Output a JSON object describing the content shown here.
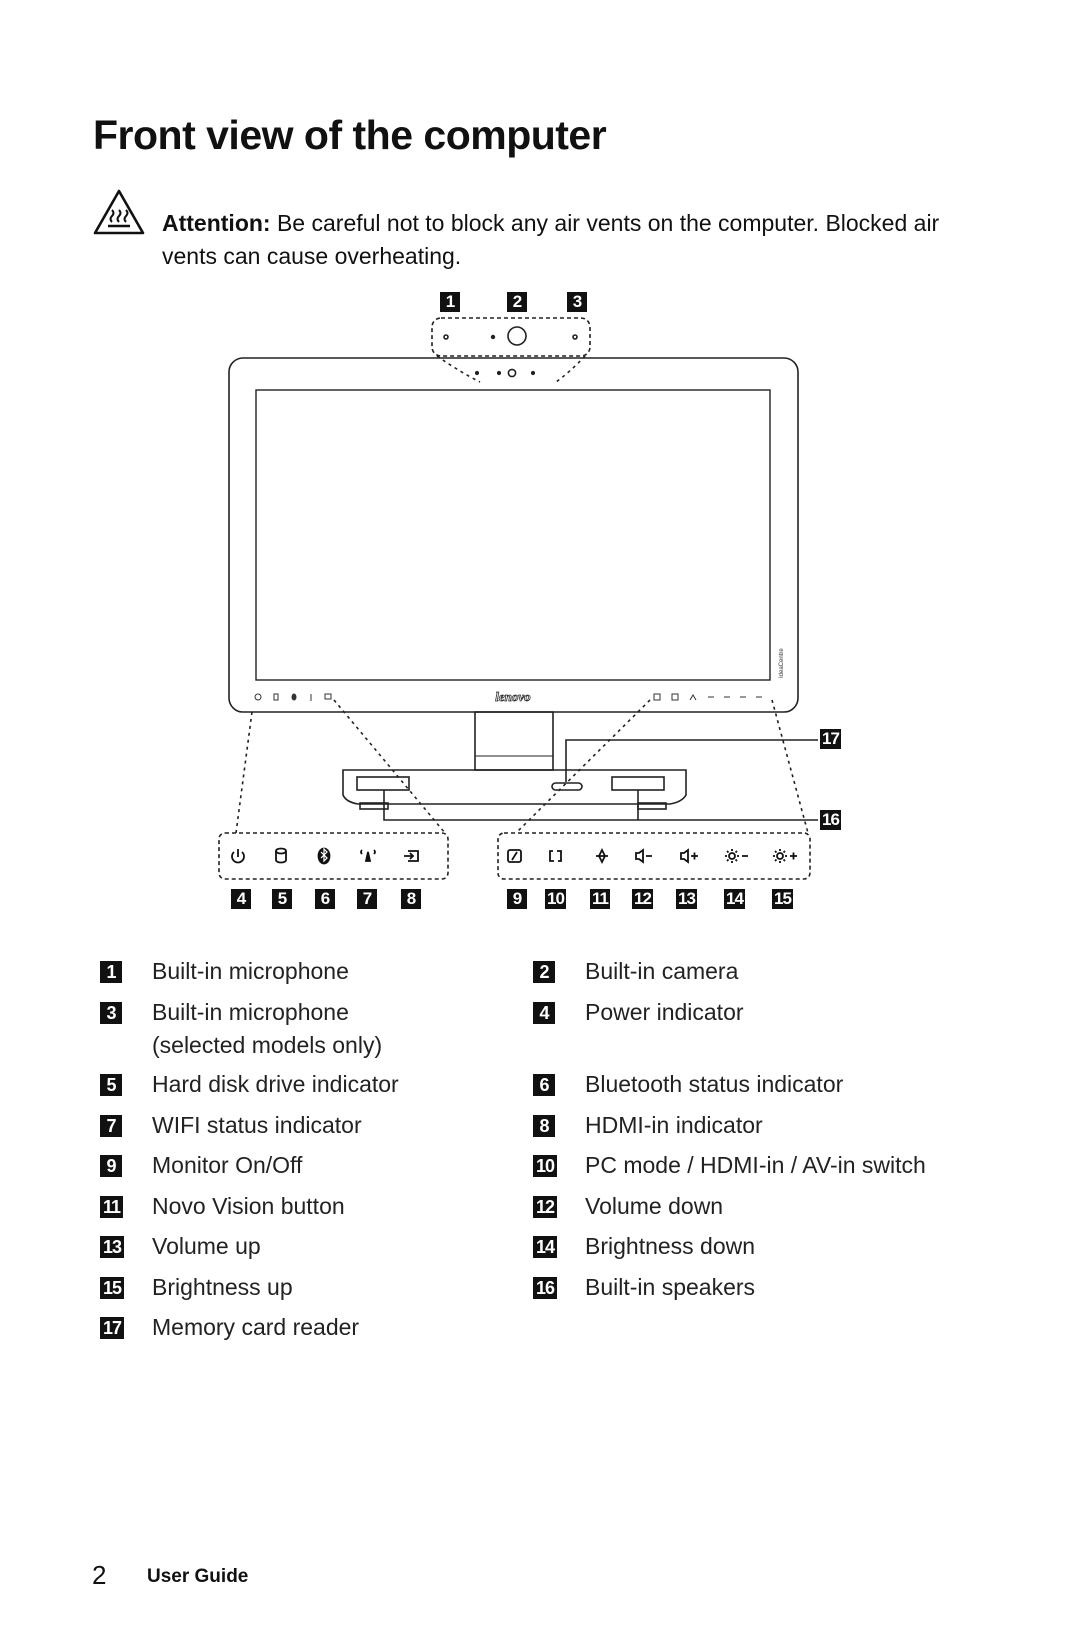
{
  "page": {
    "title": "Front view of the computer",
    "attention": {
      "icon": "hot-surface-warning-icon",
      "label": "Attention:",
      "text": "Be careful not to block any air vents on the computer. Blocked air vents can cause overheating."
    },
    "figure": {
      "brand_logo": "lenovo",
      "side_text": "IdeaCentre",
      "callouts_top": [
        "1",
        "2",
        "3"
      ],
      "callouts_left": [
        "4",
        "5",
        "6",
        "7",
        "8"
      ],
      "callouts_right": [
        "9",
        "10",
        "11",
        "12",
        "13",
        "14",
        "15"
      ],
      "callout_memory": "17",
      "callout_speakers": "16",
      "left_panel_icons": [
        "power-icon",
        "hard-disk-icon",
        "bluetooth-icon",
        "wifi-antenna-icon",
        "hdmi-input-icon"
      ],
      "right_panel_icons": [
        "monitor-onoff-icon",
        "mode-switch-icon",
        "novo-vision-icon",
        "volume-down-icon",
        "volume-up-icon",
        "brightness-down-icon",
        "brightness-up-icon"
      ]
    },
    "legend": [
      {
        "num": "1",
        "label": "Built-in microphone"
      },
      {
        "num": "2",
        "label": "Built-in camera"
      },
      {
        "num": "3",
        "label": "Built-in microphone",
        "label2": "(selected models only)"
      },
      {
        "num": "4",
        "label": "Power indicator"
      },
      {
        "num": "5",
        "label": "Hard disk drive indicator"
      },
      {
        "num": "6",
        "label": "Bluetooth status indicator"
      },
      {
        "num": "7",
        "label": "WIFI status indicator"
      },
      {
        "num": "8",
        "label": "HDMI-in indicator"
      },
      {
        "num": "9",
        "label": "Monitor On/Off"
      },
      {
        "num": "10",
        "label": "PC mode / HDMI-in / AV-in switch"
      },
      {
        "num": "11",
        "label": "Novo Vision button"
      },
      {
        "num": "12",
        "label": "Volume down"
      },
      {
        "num": "13",
        "label": "Volume up"
      },
      {
        "num": "14",
        "label": "Brightness down"
      },
      {
        "num": "15",
        "label": "Brightness up"
      },
      {
        "num": "16",
        "label": "Built-in speakers"
      },
      {
        "num": "17",
        "label": "Memory card reader"
      }
    ],
    "footer": {
      "page_number": "2",
      "doc_title": "User Guide"
    }
  }
}
